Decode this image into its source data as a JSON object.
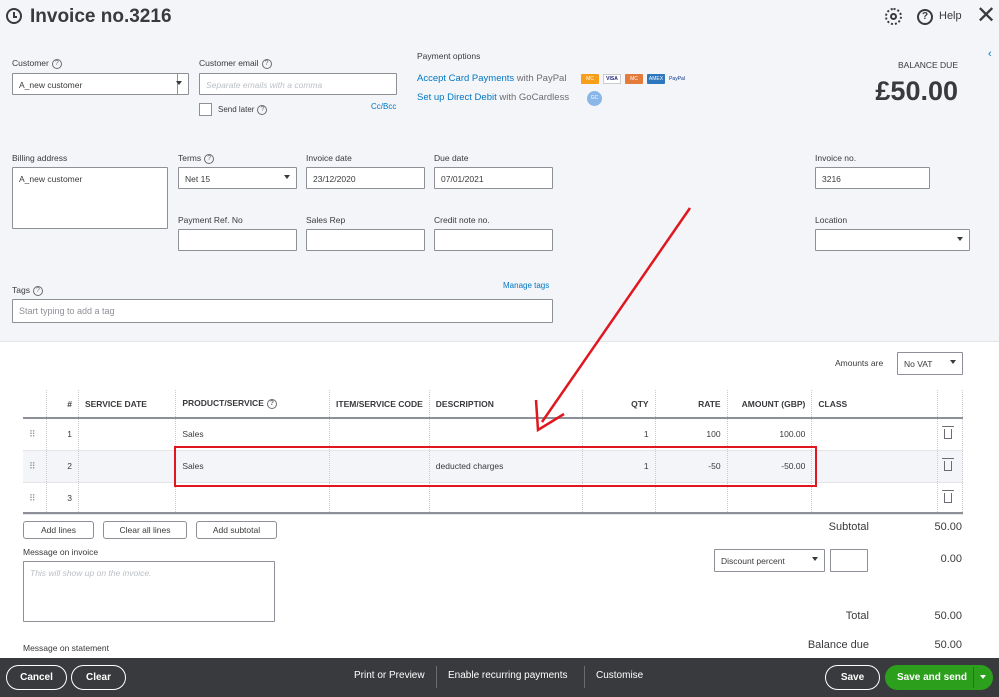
{
  "header": {
    "title": "Invoice no.3216",
    "help_label": "Help"
  },
  "customer": {
    "label": "Customer",
    "value": "A_new customer"
  },
  "customer_email": {
    "label": "Customer email",
    "placeholder": "Separate emails with a comma",
    "send_later_label": "Send later",
    "cc_bcc_label": "Cc/Bcc"
  },
  "payment_options": {
    "title": "Payment options",
    "card_link": "Accept Card Payments",
    "card_suffix": "with PayPal",
    "card_icons": [
      "MC",
      "VISA",
      "AMEX",
      "PayPal"
    ],
    "debit_link": "Set up Direct Debit",
    "debit_suffix": "with GoCardless",
    "gc_icon": "GC"
  },
  "balance": {
    "label": "BALANCE DUE",
    "value": "£50.00"
  },
  "billing": {
    "label": "Billing address",
    "value": "A_new customer"
  },
  "terms": {
    "label": "Terms",
    "value": "Net 15"
  },
  "invoice_date": {
    "label": "Invoice date",
    "value": "23/12/2020"
  },
  "due_date": {
    "label": "Due date",
    "value": "07/01/2021"
  },
  "invoice_no": {
    "label": "Invoice no.",
    "value": "3216"
  },
  "payment_ref": {
    "label": "Payment Ref. No",
    "value": ""
  },
  "sales_rep": {
    "label": "Sales Rep",
    "value": ""
  },
  "credit_note": {
    "label": "Credit note no.",
    "value": ""
  },
  "location": {
    "label": "Location",
    "value": ""
  },
  "tags": {
    "label": "Tags",
    "manage_label": "Manage tags",
    "placeholder": "Start typing to add a tag"
  },
  "amounts_are": {
    "label": "Amounts are",
    "value": "No VAT"
  },
  "table": {
    "headers": [
      "#",
      "SERVICE DATE",
      "PRODUCT/SERVICE",
      "ITEM/SERVICE CODE",
      "DESCRIPTION",
      "QTY",
      "RATE",
      "AMOUNT (GBP)",
      "CLASS"
    ],
    "rows": [
      {
        "num": "1",
        "date": "",
        "product": "Sales",
        "code": "",
        "desc": "",
        "qty": "1",
        "rate": "100",
        "amount": "100.00",
        "class": ""
      },
      {
        "num": "2",
        "date": "",
        "product": "Sales",
        "code": "",
        "desc": "deducted charges",
        "qty": "1",
        "rate": "-50",
        "amount": "-50.00",
        "class": ""
      },
      {
        "num": "3",
        "date": "",
        "product": "",
        "code": "",
        "desc": "",
        "qty": "",
        "rate": "",
        "amount": "",
        "class": ""
      }
    ]
  },
  "line_buttons": {
    "add_lines": "Add lines",
    "clear_all": "Clear all lines",
    "add_subtotal": "Add subtotal"
  },
  "message_invoice": {
    "label": "Message on invoice",
    "placeholder": "This will show up on the invoice."
  },
  "message_statement": {
    "label": "Message on statement"
  },
  "totals": {
    "subtotal_label": "Subtotal",
    "subtotal_value": "50.00",
    "discount_select": "Discount percent",
    "discount_value": "0.00",
    "total_label": "Total",
    "total_value": "50.00",
    "balance_due_label": "Balance due",
    "balance_due_value": "50.00"
  },
  "footer": {
    "cancel": "Cancel",
    "clear": "Clear",
    "print_preview": "Print or Preview",
    "recurring": "Enable recurring payments",
    "customise": "Customise",
    "save": "Save",
    "save_send": "Save and send"
  },
  "colors": {
    "accent": "#0077c5",
    "annotation": "#e0171f",
    "save_send": "#2ca01c",
    "footer_bg": "#393a3d"
  }
}
